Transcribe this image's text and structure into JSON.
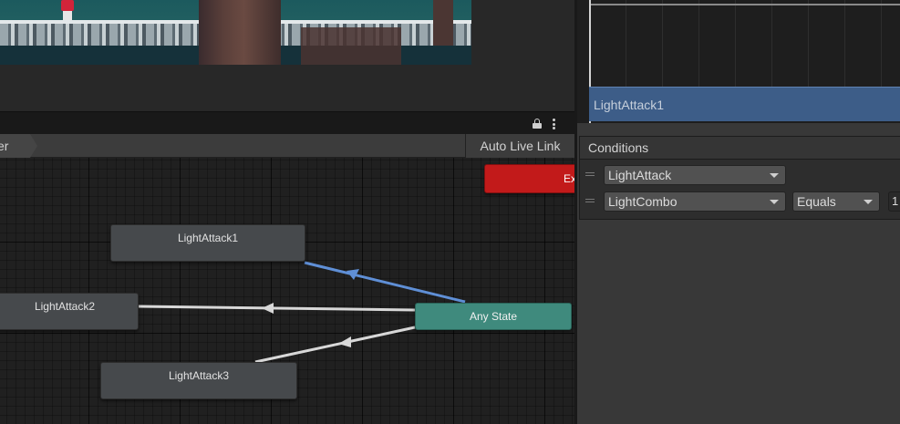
{
  "animator": {
    "breadcrumb": "Base Layer",
    "breadcrumb_visible": "yer",
    "auto_live_link": "Auto Live Link"
  },
  "graph": {
    "nodes": {
      "exit": "Exit",
      "light_attack_1": "LightAttack1",
      "light_attack_2": "LightAttack2",
      "light_attack_3": "LightAttack3",
      "any_state": "Any State"
    }
  },
  "inspector": {
    "clip_label": "LightAttack1",
    "conditions_header": "Conditions",
    "conditions": [
      {
        "parameter": "LightAttack"
      },
      {
        "parameter": "LightCombo",
        "mode": "Equals",
        "value": "1"
      }
    ]
  },
  "colors": {
    "selected_transition": "#5f8fd6",
    "transition": "#d8d8d8",
    "any_state": "#3f8a7d",
    "exit_state": "#c21a1a",
    "clip_bar": "#3d5d88"
  }
}
